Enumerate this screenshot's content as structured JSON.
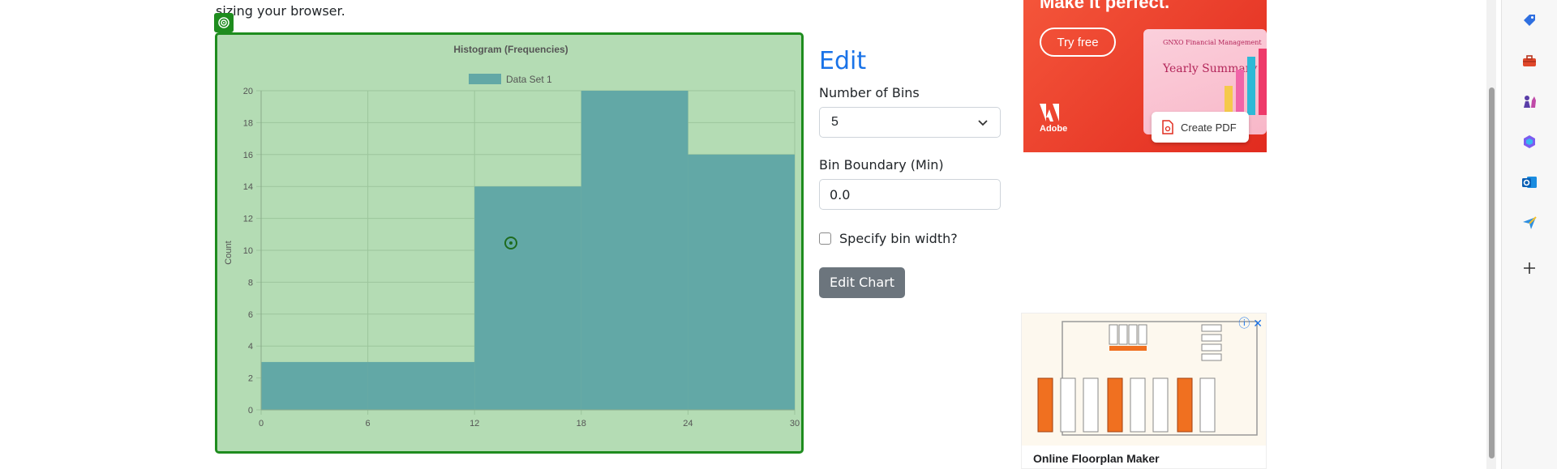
{
  "intro": {
    "text": "sizing your browser."
  },
  "chart_data": {
    "type": "bar",
    "title": "Histogram (Frequencies)",
    "xlabel": "",
    "ylabel": "Count",
    "legend": "top",
    "series": [
      {
        "name": "Data Set 1",
        "values": [
          3,
          3,
          14,
          20,
          16
        ]
      }
    ],
    "bin_edges": [
      0,
      6,
      12,
      18,
      24,
      30
    ],
    "x_ticks": [
      "0",
      "6",
      "12",
      "18",
      "24",
      "30"
    ],
    "y_ticks": [
      "0",
      "2",
      "4",
      "6",
      "8",
      "10",
      "12",
      "14",
      "16",
      "18",
      "20"
    ],
    "ylim": [
      0,
      20
    ],
    "xlim": [
      0,
      30
    ],
    "grid": true,
    "colors": {
      "bar": "#62a8a6",
      "background": "#b4dcb4",
      "grid": "#9cc59c"
    }
  },
  "edit": {
    "title": "Edit",
    "bins_label": "Number of Bins",
    "bins_value": "5",
    "boundary_label": "Bin Boundary (Min)",
    "boundary_value": "0.0",
    "bin_width_label": "Specify bin width?",
    "button_label": "Edit Chart"
  },
  "ads": {
    "top": {
      "headline": "Make it perfect.",
      "cta": "Try free",
      "brand_text": "GNXO Financial Management",
      "laptop_text": "Yearly Summary",
      "pdf_button": "Create PDF",
      "advertiser": "Adobe"
    },
    "bottom": {
      "caption": "Online Floorplan Maker"
    }
  },
  "edge_sidebar": {
    "icons": [
      "tag-icon",
      "toolbox-icon",
      "chess-icon",
      "copilot-icon",
      "outlook-icon",
      "send-icon",
      "add-icon"
    ]
  }
}
